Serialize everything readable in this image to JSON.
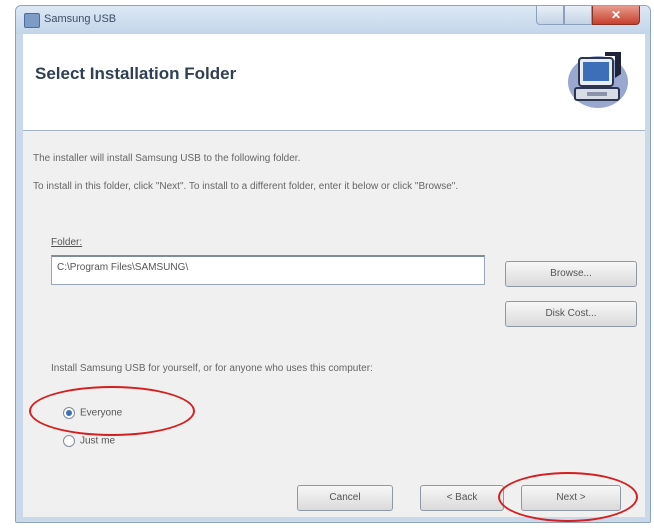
{
  "window": {
    "title": "Samsung USB",
    "close_glyph": "✕",
    "icons": {
      "app": "app-icon",
      "header": "computer-install-icon"
    }
  },
  "header": {
    "title": "Select Installation Folder"
  },
  "body": {
    "line1": "The installer will install Samsung USB to the following folder.",
    "line2": "To install in this folder, click \"Next\". To install to a different folder, enter it below or click \"Browse\".",
    "folder_label": "Folder:",
    "folder_value": "C:\\Program Files\\SAMSUNG\\",
    "install_desc": "Install Samsung USB for yourself, or for anyone who uses this computer:",
    "radio_everyone": "Everyone",
    "radio_justme": "Just me",
    "selected_radio": "Everyone"
  },
  "buttons": {
    "browse": "Browse...",
    "disk_cost": "Disk Cost...",
    "cancel": "Cancel",
    "back": "< Back",
    "next": "Next >"
  },
  "annotations": {
    "color": "#d42020"
  }
}
